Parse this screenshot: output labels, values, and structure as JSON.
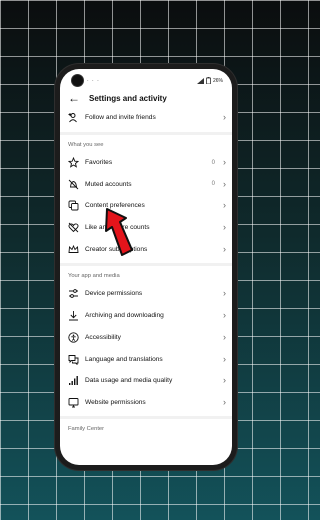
{
  "status": {
    "left": "· · ·",
    "battery": "26%"
  },
  "header": {
    "title": "Settings and activity"
  },
  "top_item": {
    "label": "Follow and invite friends",
    "icon": "add-person-icon"
  },
  "sections": [
    {
      "title": "What you see",
      "items": [
        {
          "label": "Favorites",
          "count": "0",
          "icon": "star-icon"
        },
        {
          "label": "Muted accounts",
          "count": "0",
          "icon": "muted-bell-icon"
        },
        {
          "label": "Content preferences",
          "count": "",
          "icon": "content-icon"
        },
        {
          "label": "Like and share counts",
          "count": "",
          "icon": "heart-off-icon"
        },
        {
          "label": "Creator subscriptions",
          "count": "",
          "icon": "crown-icon"
        }
      ]
    },
    {
      "title": "Your app and media",
      "items": [
        {
          "label": "Device permissions",
          "count": "",
          "icon": "toggle-icon"
        },
        {
          "label": "Archiving and downloading",
          "count": "",
          "icon": "download-icon"
        },
        {
          "label": "Accessibility",
          "count": "",
          "icon": "accessibility-icon"
        },
        {
          "label": "Language and translations",
          "count": "",
          "icon": "translate-icon"
        },
        {
          "label": "Data usage and media quality",
          "count": "",
          "icon": "signal-icon"
        },
        {
          "label": "Website permissions",
          "count": "",
          "icon": "monitor-icon"
        }
      ]
    }
  ],
  "footer_section": {
    "title": "Family Center"
  },
  "colors": {
    "arrow": "#e3141b",
    "background": "#0f2a2c"
  }
}
